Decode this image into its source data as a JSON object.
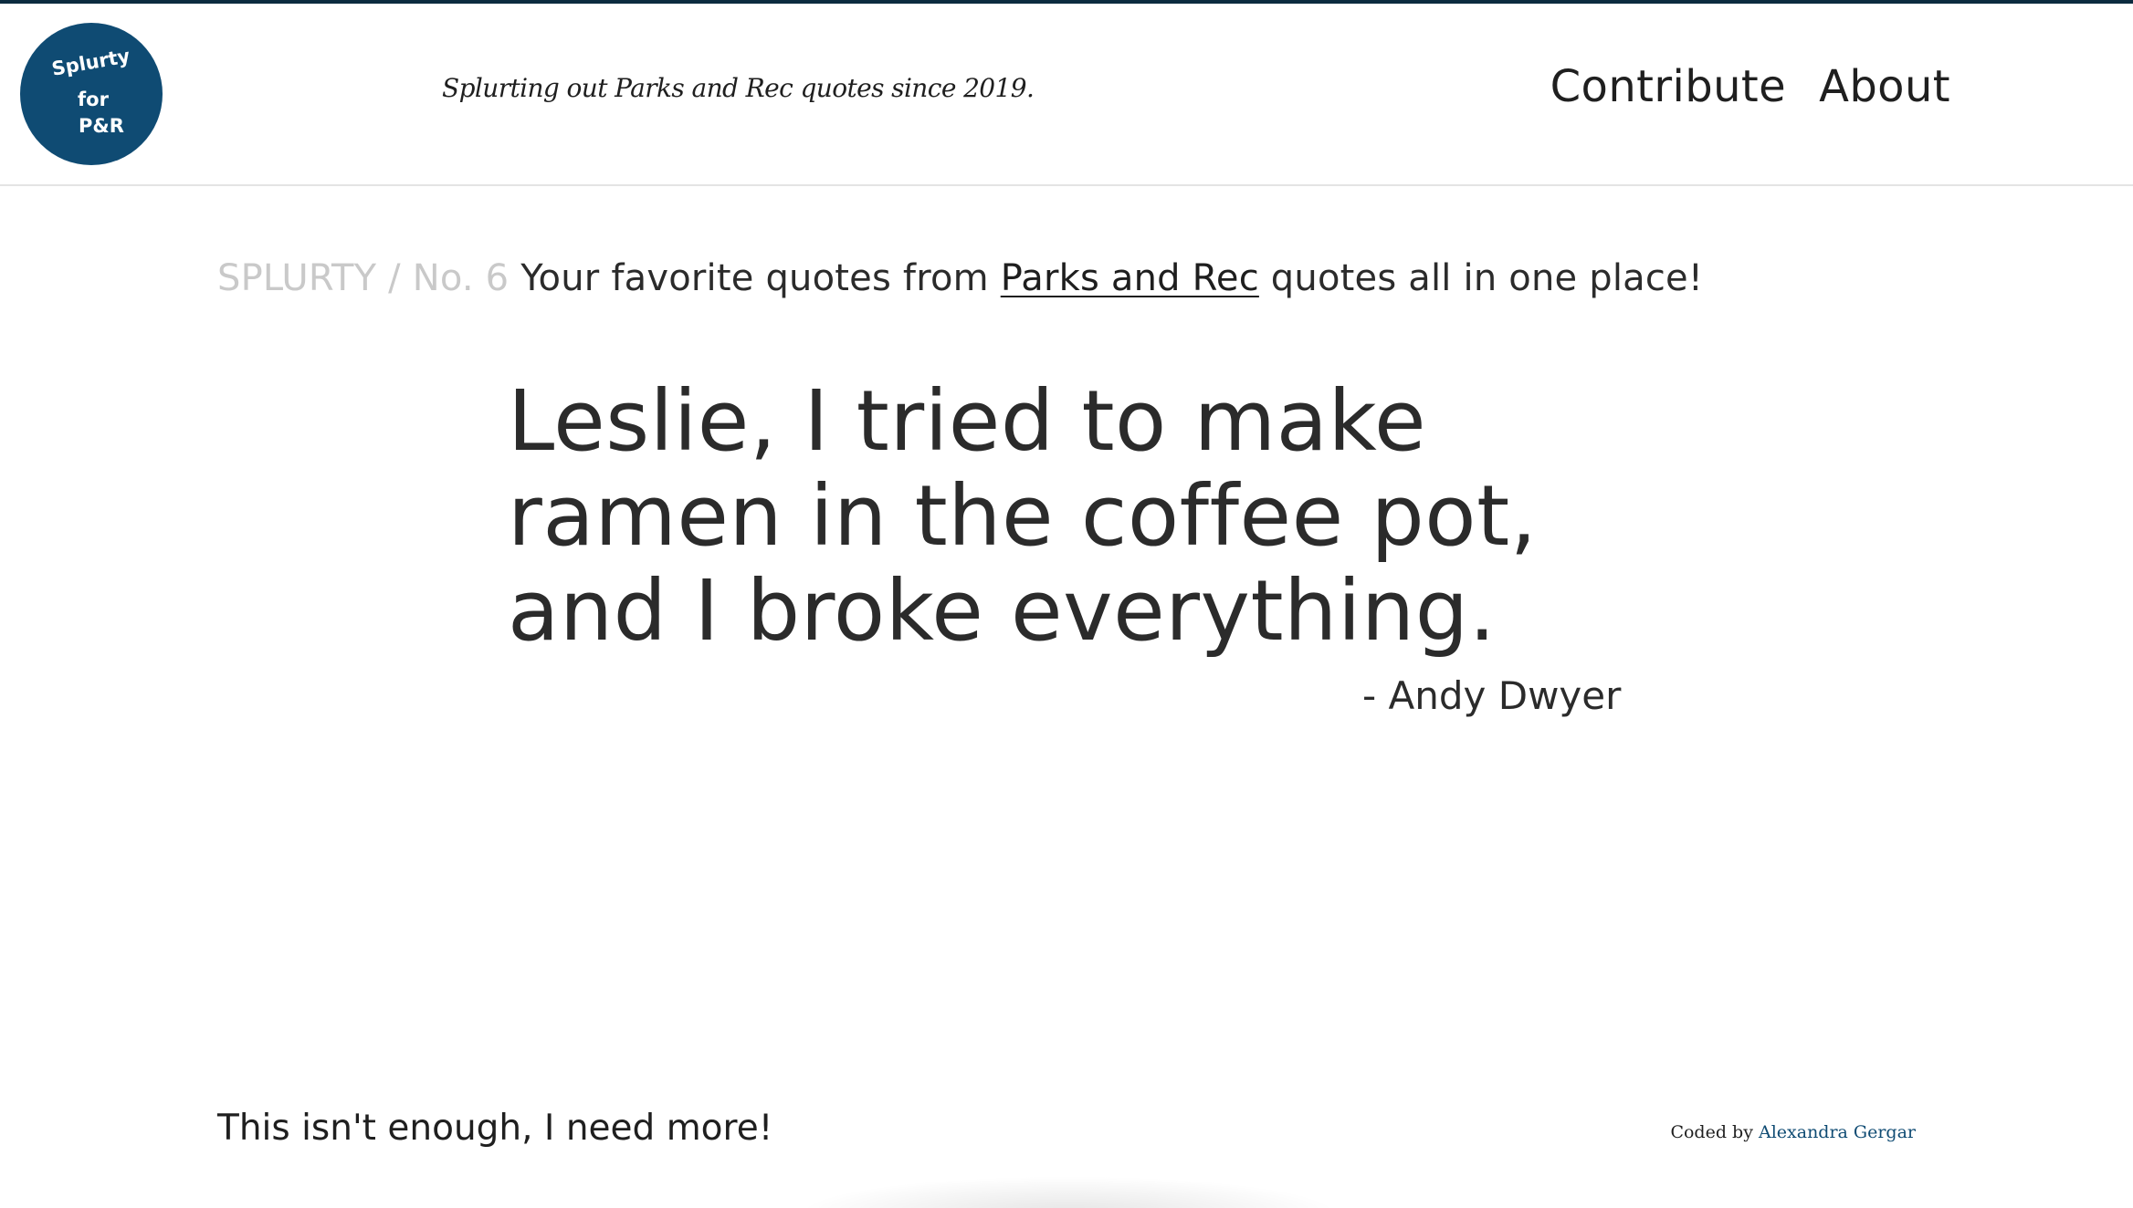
{
  "colors": {
    "brand": "#0f4b73",
    "top_bar": "#0c2b3f",
    "text": "#2b2b2b",
    "muted": "#c9c9c9"
  },
  "header": {
    "logo": {
      "line1": "Splurty",
      "line2": "for",
      "line3": "P&R"
    },
    "tagline": "Splurting out Parks and Rec quotes since 2019.",
    "nav": {
      "contribute": "Contribute",
      "about": "About"
    }
  },
  "intro": {
    "crumb": "SPLURTY / No. 6",
    "text_before": "Your favorite quotes from ",
    "link": "Parks and Rec",
    "text_after": " quotes all in one place!"
  },
  "quote": {
    "lines": [
      "Leslie, I tried to make",
      "ramen in the coffee pot,",
      "and I broke everything."
    ],
    "author": "- Andy Dwyer"
  },
  "footer": {
    "more_link": "This isn't enough, I need more!",
    "credit_prefix": "Coded by ",
    "credit_name": "Alexandra Gergar"
  }
}
